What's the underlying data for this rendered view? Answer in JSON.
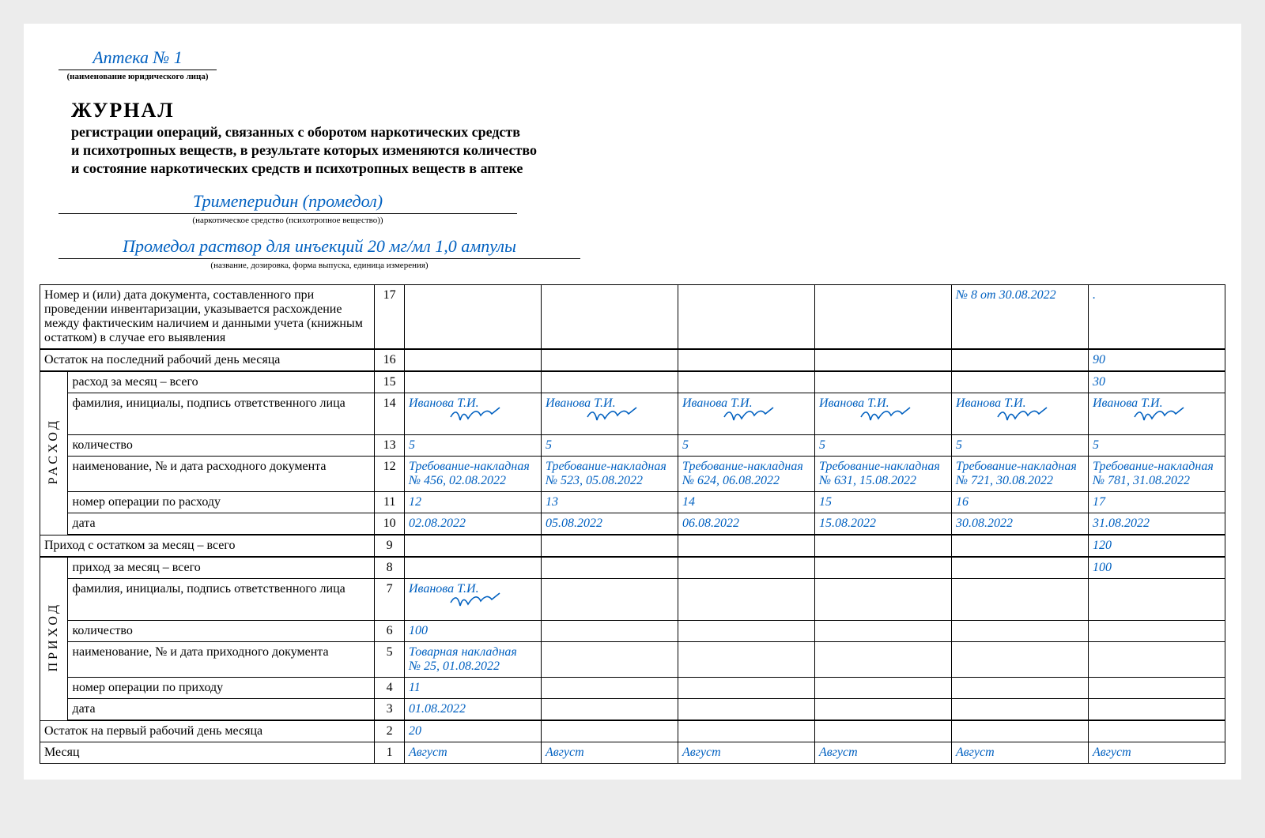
{
  "pharmacy": {
    "name": "Аптека № 1",
    "caption": "(наименование юридического лица)"
  },
  "title": {
    "main": "ЖУРНАЛ",
    "line1": "регистрации операций, связанных с оборотом наркотических средств",
    "line2": "и психотропных веществ, в результате которых изменяются количество",
    "line3": "и состояние наркотических средств и психотропных веществ в аптеке"
  },
  "drug": {
    "name": "Тримеперидин (промедол)",
    "caption": "(наркотическое средство (психотропное вещество))"
  },
  "form": {
    "name": "Промедол раствор для инъекций 20 мг/мл 1,0 ампулы",
    "caption": "(название, дозировка, форма выпуска, единица измерения)"
  },
  "vert": {
    "rashod": "РАСХОД",
    "prihod": "ПРИХОД"
  },
  "rows": {
    "r17": {
      "label": "Номер и (или) дата документа, составленного при проведении инвентаризации, указывается расхож­дение между фактическим наличием и данными учета (книжным остатком) в случае его выявления",
      "num": "17",
      "c5": "№ 8 от 30.08.2022",
      "c6": "."
    },
    "r16": {
      "label": "Остаток на последний рабочий день месяца",
      "num": "16",
      "c6": "90"
    },
    "r15": {
      "label": "расход за месяц – всего",
      "num": "15",
      "c6": "30"
    },
    "r14": {
      "label": "фамилия, инициалы, подпись ответствен­ного лица",
      "num": "14",
      "sig": "Иванова Т.И."
    },
    "r13": {
      "label": "количество",
      "num": "13",
      "c1": "5",
      "c2": "5",
      "c3": "5",
      "c4": "5",
      "c5": "5",
      "c6": "5"
    },
    "r12": {
      "label": "наименование, № и дата расходного доку­мента",
      "num": "12",
      "c1a": "Требование-накладная",
      "c1b": "№ 456, 02.08.2022",
      "c2a": "Требование-накладная",
      "c2b": "№ 523, 05.08.2022",
      "c3a": "Требование-накладная",
      "c3b": "№ 624, 06.08.2022",
      "c4a": "Требование-накладная",
      "c4b": "№ 631, 15.08.2022",
      "c5a": "Требование-накладная",
      "c5b": "№ 721, 30.08.2022",
      "c6a": "Требование-накладная",
      "c6b": "№ 781, 31.08.2022"
    },
    "r11": {
      "label": "номер операции по расходу",
      "num": "11",
      "c1": "12",
      "c2": "13",
      "c3": "14",
      "c4": "15",
      "c5": "16",
      "c6": "17"
    },
    "r10": {
      "label": "дата",
      "num": "10",
      "c1": "02.08.2022",
      "c2": "05.08.2022",
      "c3": "06.08.2022",
      "c4": "15.08.2022",
      "c5": "30.08.2022",
      "c6": "31.08.2022"
    },
    "r9": {
      "label": "Приход с остатком за месяц – всего",
      "num": "9",
      "c6": "120"
    },
    "r8": {
      "label": "приход за месяц – всего",
      "num": "8",
      "c6": "100"
    },
    "r7": {
      "label": "фамилия, инициалы, подпись ответствен­ного лица",
      "num": "7",
      "sig": "Иванова Т.И."
    },
    "r6": {
      "label": "количество",
      "num": "6",
      "c1": "100"
    },
    "r5": {
      "label": "наименование, № и дата приходного документа",
      "num": "5",
      "c1a": "Товарная накладная",
      "c1b": "№ 25, 01.08.2022"
    },
    "r4": {
      "label": "номер операции по приходу",
      "num": "4",
      "c1": "11"
    },
    "r3": {
      "label": "дата",
      "num": "3",
      "c1": "01.08.2022"
    },
    "r2": {
      "label": "Остаток на первый рабочий день месяца",
      "num": "2",
      "c1": "20"
    },
    "r1": {
      "label": "Месяц",
      "num": "1",
      "c1": "Август",
      "c2": "Август",
      "c3": "Август",
      "c4": "Август",
      "c5": "Август",
      "c6": "Август"
    }
  }
}
